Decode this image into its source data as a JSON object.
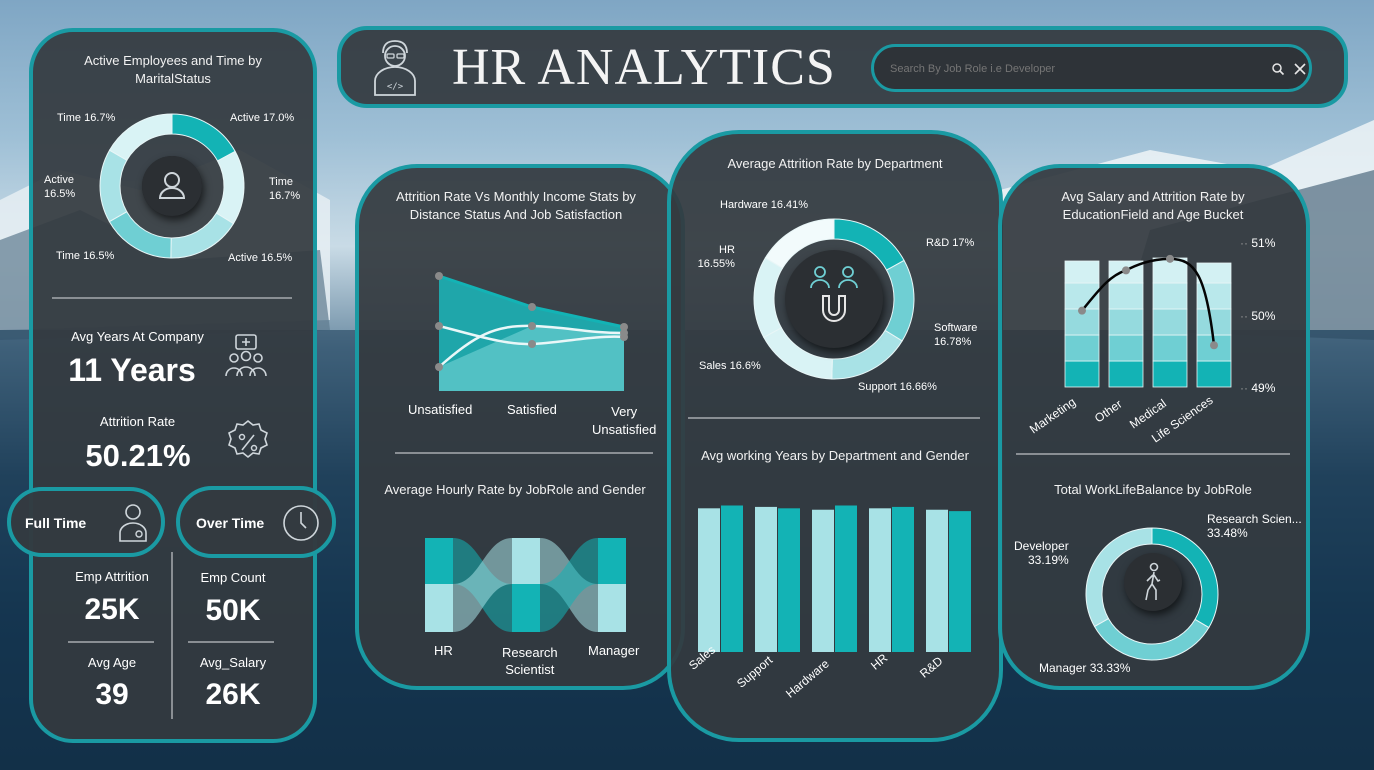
{
  "header": {
    "title": "HR ANALYTICS",
    "search_placeholder": "Search By Job Role i.e Developer"
  },
  "colors": {
    "teal": "#13b3b5",
    "mid": "#6fcfd3",
    "light": "#a8e2e6",
    "pale": "#d9f3f5",
    "panel": "#343a40",
    "border": "#1a9aa3"
  },
  "marital": {
    "title": "Active Employees and Time by MaritalStatus",
    "labels": [
      "Active 17.0%",
      "Time 16.7%",
      "Active 16.5%",
      "Time 16.5%",
      "Active 16.5%",
      "Time 16.7%"
    ],
    "label_parts": {
      "time_right_1": "Time",
      "time_right_2": "16.7%",
      "active_left_1": "Active",
      "active_left_2": "16.5%"
    }
  },
  "kpis": {
    "avg_years_label": "Avg Years At Company",
    "avg_years_value": "11 Years",
    "attrition_label": "Attrition Rate",
    "attrition_value": "50.21%",
    "full_time": "Full Time",
    "over_time": "Over Time",
    "emp_attrition_label": "Emp Attrition",
    "emp_attrition_value": "25K",
    "emp_count_label": "Emp Count",
    "emp_count_value": "50K",
    "avg_age_label": "Avg Age",
    "avg_age_value": "39",
    "avg_salary_label": "Avg_Salary",
    "avg_salary_value": "26K"
  },
  "income_chart": {
    "title": "Attrition Rate Vs Monthly Income Stats by Distance Status And Job Satisfaction",
    "categories": [
      "Unsatisfied",
      "Satisfied",
      "Very Unsatisfied"
    ],
    "cat_lines": [
      "Very",
      "Unsatisfied"
    ]
  },
  "hourly_chart": {
    "title": "Average Hourly Rate by JobRole and Gender",
    "categories": [
      "HR",
      "Research Scientist",
      "Manager"
    ],
    "research_1": "Research",
    "research_2": "Scientist"
  },
  "dept_attrition": {
    "title": "Average Attrition Rate by Department",
    "slices": [
      {
        "label": "R&D 17%",
        "value": 17
      },
      {
        "label": "Software 16.78%",
        "value": 16.78
      },
      {
        "label": "Support 16.66%",
        "value": 16.66
      },
      {
        "label": "Sales 16.6%",
        "value": 16.6
      },
      {
        "label": "HR 16.55%",
        "value": 16.55
      },
      {
        "label": "Hardware 16.41%",
        "value": 16.41
      }
    ],
    "text": {
      "hardware": "Hardware 16.41%",
      "rd": "R&D 17%",
      "hr1": "HR",
      "hr2": "16.55%",
      "sw1": "Software",
      "sw2": "16.78%",
      "sales": "Sales 16.6%",
      "support": "Support 16.66%"
    }
  },
  "working_years": {
    "title": "Avg working Years by Department and Gender",
    "categories": [
      "Sales",
      "Support",
      "Hardware",
      "HR",
      "R&D"
    ],
    "series": [
      {
        "values": [
          10.2,
          10.3,
          10.1,
          10.2,
          10.1
        ]
      },
      {
        "values": [
          10.4,
          10.2,
          10.4,
          10.3,
          10.0
        ]
      }
    ]
  },
  "salary_chart": {
    "title": "Avg Salary and Attrition Rate by EducationField and Age Bucket",
    "categories": [
      "Marketing",
      "Other",
      "Medical",
      "Life Sciences"
    ],
    "y2_ticks": [
      "51%",
      "50%",
      "49%"
    ],
    "attrition_values": [
      50.06,
      50.62,
      50.78,
      49.58
    ]
  },
  "wlb_chart": {
    "title": "Total WorkLifeBalance by JobRole",
    "slices": [
      {
        "label": "Research Scien...",
        "value": 33.48
      },
      {
        "label": "Manager",
        "value": 33.33
      },
      {
        "label": "Developer",
        "value": 33.19
      }
    ],
    "text": {
      "rs1": "Research Scien...",
      "rs2": "33.48%",
      "dev1": "Developer",
      "dev2": "33.19%",
      "mgr": "Manager 33.33%"
    }
  }
}
